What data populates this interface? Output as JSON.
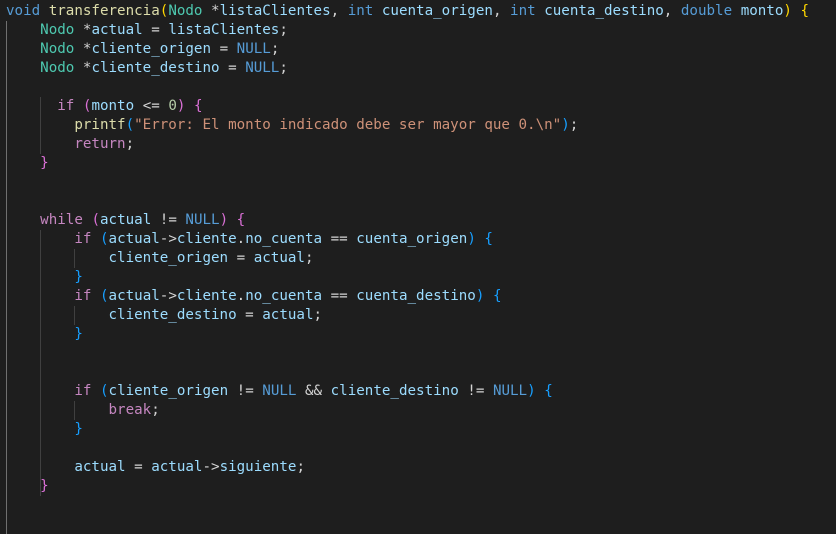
{
  "editor": {
    "colors": {
      "background": "#1e1e1e",
      "keyword": "#569cd6",
      "control": "#c586c0",
      "function": "#dcdcaa",
      "type": "#4ec9b0",
      "variable": "#9cdcfe",
      "string": "#ce9178",
      "number": "#b5cea8",
      "text": "#d4d4d4",
      "bracket_gold": "#ffd700",
      "bracket_pink": "#da70d6",
      "bracket_blue": "#179fff"
    },
    "lines": [
      {
        "indent": 0,
        "tokens": [
          {
            "t": "void",
            "c": "keyword"
          },
          {
            "t": " ",
            "c": "text"
          },
          {
            "t": "transferencia",
            "c": "function"
          },
          {
            "t": "(",
            "c": "bracket_gold"
          },
          {
            "t": "Nodo",
            "c": "type"
          },
          {
            "t": " *",
            "c": "text"
          },
          {
            "t": "listaClientes",
            "c": "variable"
          },
          {
            "t": ", ",
            "c": "text"
          },
          {
            "t": "int",
            "c": "keyword"
          },
          {
            "t": " ",
            "c": "text"
          },
          {
            "t": "cuenta_origen",
            "c": "variable"
          },
          {
            "t": ", ",
            "c": "text"
          },
          {
            "t": "int",
            "c": "keyword"
          },
          {
            "t": " ",
            "c": "text"
          },
          {
            "t": "cuenta_destino",
            "c": "variable"
          },
          {
            "t": ", ",
            "c": "text"
          },
          {
            "t": "double",
            "c": "keyword"
          },
          {
            "t": " ",
            "c": "text"
          },
          {
            "t": "monto",
            "c": "variable"
          },
          {
            "t": ")",
            "c": "bracket_gold"
          },
          {
            "t": " ",
            "c": "text"
          },
          {
            "t": "{",
            "c": "bracket_gold"
          }
        ]
      },
      {
        "indent": 4,
        "tokens": [
          {
            "t": "Nodo",
            "c": "type"
          },
          {
            "t": " *",
            "c": "text"
          },
          {
            "t": "actual",
            "c": "variable"
          },
          {
            "t": " = ",
            "c": "text"
          },
          {
            "t": "listaClientes",
            "c": "variable"
          },
          {
            "t": ";",
            "c": "text"
          }
        ]
      },
      {
        "indent": 4,
        "tokens": [
          {
            "t": "Nodo",
            "c": "type"
          },
          {
            "t": " *",
            "c": "text"
          },
          {
            "t": "cliente_origen",
            "c": "variable"
          },
          {
            "t": " = ",
            "c": "text"
          },
          {
            "t": "NULL",
            "c": "keyword"
          },
          {
            "t": ";",
            "c": "text"
          }
        ]
      },
      {
        "indent": 4,
        "tokens": [
          {
            "t": "Nodo",
            "c": "type"
          },
          {
            "t": " *",
            "c": "text"
          },
          {
            "t": "cliente_destino",
            "c": "variable"
          },
          {
            "t": " = ",
            "c": "text"
          },
          {
            "t": "NULL",
            "c": "keyword"
          },
          {
            "t": ";",
            "c": "text"
          }
        ]
      },
      {
        "indent": 0,
        "tokens": []
      },
      {
        "indent": 6,
        "tokens": [
          {
            "t": "if",
            "c": "control"
          },
          {
            "t": " ",
            "c": "text"
          },
          {
            "t": "(",
            "c": "bracket_pink"
          },
          {
            "t": "monto",
            "c": "variable"
          },
          {
            "t": " <= ",
            "c": "text"
          },
          {
            "t": "0",
            "c": "number"
          },
          {
            "t": ")",
            "c": "bracket_pink"
          },
          {
            "t": " ",
            "c": "text"
          },
          {
            "t": "{",
            "c": "bracket_pink"
          }
        ]
      },
      {
        "indent": 8,
        "tokens": [
          {
            "t": "printf",
            "c": "function"
          },
          {
            "t": "(",
            "c": "bracket_blue"
          },
          {
            "t": "\"Error: El monto indicado debe ser mayor que 0.\\n\"",
            "c": "string"
          },
          {
            "t": ")",
            "c": "bracket_blue"
          },
          {
            "t": ";",
            "c": "text"
          }
        ]
      },
      {
        "indent": 8,
        "tokens": [
          {
            "t": "return",
            "c": "control"
          },
          {
            "t": ";",
            "c": "text"
          }
        ]
      },
      {
        "indent": 4,
        "tokens": [
          {
            "t": "}",
            "c": "bracket_pink"
          }
        ]
      },
      {
        "indent": 0,
        "tokens": []
      },
      {
        "indent": 0,
        "tokens": []
      },
      {
        "indent": 4,
        "tokens": [
          {
            "t": "while",
            "c": "control"
          },
          {
            "t": " ",
            "c": "text"
          },
          {
            "t": "(",
            "c": "bracket_pink"
          },
          {
            "t": "actual",
            "c": "variable"
          },
          {
            "t": " != ",
            "c": "text"
          },
          {
            "t": "NULL",
            "c": "keyword"
          },
          {
            "t": ")",
            "c": "bracket_pink"
          },
          {
            "t": " ",
            "c": "text"
          },
          {
            "t": "{",
            "c": "bracket_pink"
          }
        ]
      },
      {
        "indent": 8,
        "tokens": [
          {
            "t": "if",
            "c": "control"
          },
          {
            "t": " ",
            "c": "text"
          },
          {
            "t": "(",
            "c": "bracket_blue"
          },
          {
            "t": "actual",
            "c": "variable"
          },
          {
            "t": "->",
            "c": "text"
          },
          {
            "t": "cliente",
            "c": "variable"
          },
          {
            "t": ".",
            "c": "text"
          },
          {
            "t": "no_cuenta",
            "c": "variable"
          },
          {
            "t": " == ",
            "c": "text"
          },
          {
            "t": "cuenta_origen",
            "c": "variable"
          },
          {
            "t": ")",
            "c": "bracket_blue"
          },
          {
            "t": " ",
            "c": "text"
          },
          {
            "t": "{",
            "c": "bracket_blue"
          }
        ]
      },
      {
        "indent": 12,
        "tokens": [
          {
            "t": "cliente_origen",
            "c": "variable"
          },
          {
            "t": " = ",
            "c": "text"
          },
          {
            "t": "actual",
            "c": "variable"
          },
          {
            "t": ";",
            "c": "text"
          }
        ]
      },
      {
        "indent": 8,
        "tokens": [
          {
            "t": "}",
            "c": "bracket_blue"
          }
        ]
      },
      {
        "indent": 8,
        "tokens": [
          {
            "t": "if",
            "c": "control"
          },
          {
            "t": " ",
            "c": "text"
          },
          {
            "t": "(",
            "c": "bracket_blue"
          },
          {
            "t": "actual",
            "c": "variable"
          },
          {
            "t": "->",
            "c": "text"
          },
          {
            "t": "cliente",
            "c": "variable"
          },
          {
            "t": ".",
            "c": "text"
          },
          {
            "t": "no_cuenta",
            "c": "variable"
          },
          {
            "t": " == ",
            "c": "text"
          },
          {
            "t": "cuenta_destino",
            "c": "variable"
          },
          {
            "t": ")",
            "c": "bracket_blue"
          },
          {
            "t": " ",
            "c": "text"
          },
          {
            "t": "{",
            "c": "bracket_blue"
          }
        ]
      },
      {
        "indent": 12,
        "tokens": [
          {
            "t": "cliente_destino",
            "c": "variable"
          },
          {
            "t": " = ",
            "c": "text"
          },
          {
            "t": "actual",
            "c": "variable"
          },
          {
            "t": ";",
            "c": "text"
          }
        ]
      },
      {
        "indent": 8,
        "tokens": [
          {
            "t": "}",
            "c": "bracket_blue"
          }
        ]
      },
      {
        "indent": 0,
        "tokens": []
      },
      {
        "indent": 0,
        "tokens": []
      },
      {
        "indent": 8,
        "tokens": [
          {
            "t": "if",
            "c": "control"
          },
          {
            "t": " ",
            "c": "text"
          },
          {
            "t": "(",
            "c": "bracket_blue"
          },
          {
            "t": "cliente_origen",
            "c": "variable"
          },
          {
            "t": " != ",
            "c": "text"
          },
          {
            "t": "NULL",
            "c": "keyword"
          },
          {
            "t": " && ",
            "c": "text"
          },
          {
            "t": "cliente_destino",
            "c": "variable"
          },
          {
            "t": " != ",
            "c": "text"
          },
          {
            "t": "NULL",
            "c": "keyword"
          },
          {
            "t": ")",
            "c": "bracket_blue"
          },
          {
            "t": " ",
            "c": "text"
          },
          {
            "t": "{",
            "c": "bracket_blue"
          }
        ]
      },
      {
        "indent": 12,
        "tokens": [
          {
            "t": "break",
            "c": "control"
          },
          {
            "t": ";",
            "c": "text"
          }
        ]
      },
      {
        "indent": 8,
        "tokens": [
          {
            "t": "}",
            "c": "bracket_blue"
          }
        ]
      },
      {
        "indent": 0,
        "tokens": []
      },
      {
        "indent": 8,
        "tokens": [
          {
            "t": "actual",
            "c": "variable"
          },
          {
            "t": " = ",
            "c": "text"
          },
          {
            "t": "actual",
            "c": "variable"
          },
          {
            "t": "->",
            "c": "text"
          },
          {
            "t": "siguiente",
            "c": "variable"
          },
          {
            "t": ";",
            "c": "text"
          }
        ]
      },
      {
        "indent": 4,
        "tokens": [
          {
            "t": "}",
            "c": "bracket_pink"
          }
        ]
      },
      {
        "indent": 0,
        "tokens": []
      }
    ]
  }
}
